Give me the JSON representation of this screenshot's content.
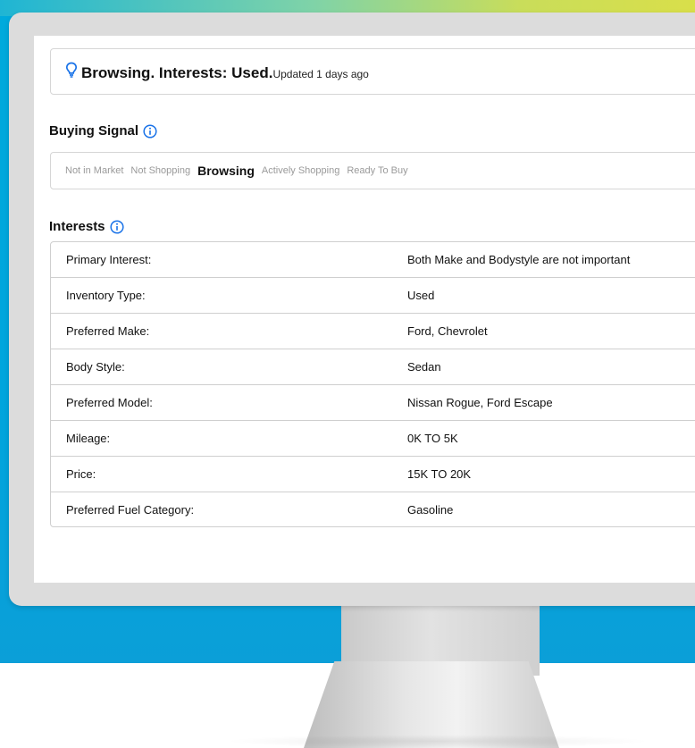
{
  "status": {
    "main_text": "Browsing. Interests: Used.",
    "updated_text": "Updated 1 days ago"
  },
  "buying_signal": {
    "title": "Buying Signal",
    "stages": [
      {
        "label": "Not in Market",
        "active": false
      },
      {
        "label": "Not Shopping",
        "active": false
      },
      {
        "label": "Browsing",
        "active": true
      },
      {
        "label": "Actively Shopping",
        "active": false
      },
      {
        "label": "Ready To Buy",
        "active": false
      }
    ]
  },
  "interests": {
    "title": "Interests",
    "rows": [
      {
        "label": "Primary Interest:",
        "value": "Both Make and Bodystyle are not important"
      },
      {
        "label": "Inventory Type:",
        "value": "Used"
      },
      {
        "label": "Preferred Make:",
        "value": "Ford, Chevrolet"
      },
      {
        "label": "Body Style:",
        "value": "Sedan"
      },
      {
        "label": "Preferred Model:",
        "value": "Nissan Rogue, Ford Escape"
      },
      {
        "label": "Mileage:",
        "value": "0K TO 5K"
      },
      {
        "label": "Price:",
        "value": "15K TO 20K"
      },
      {
        "label": "Preferred Fuel Category:",
        "value": "Gasoline"
      }
    ]
  },
  "colors": {
    "accent_blue": "#1a73e8",
    "backdrop": "#00aadc"
  },
  "icons": [
    "lightbulb-icon",
    "info-icon"
  ]
}
